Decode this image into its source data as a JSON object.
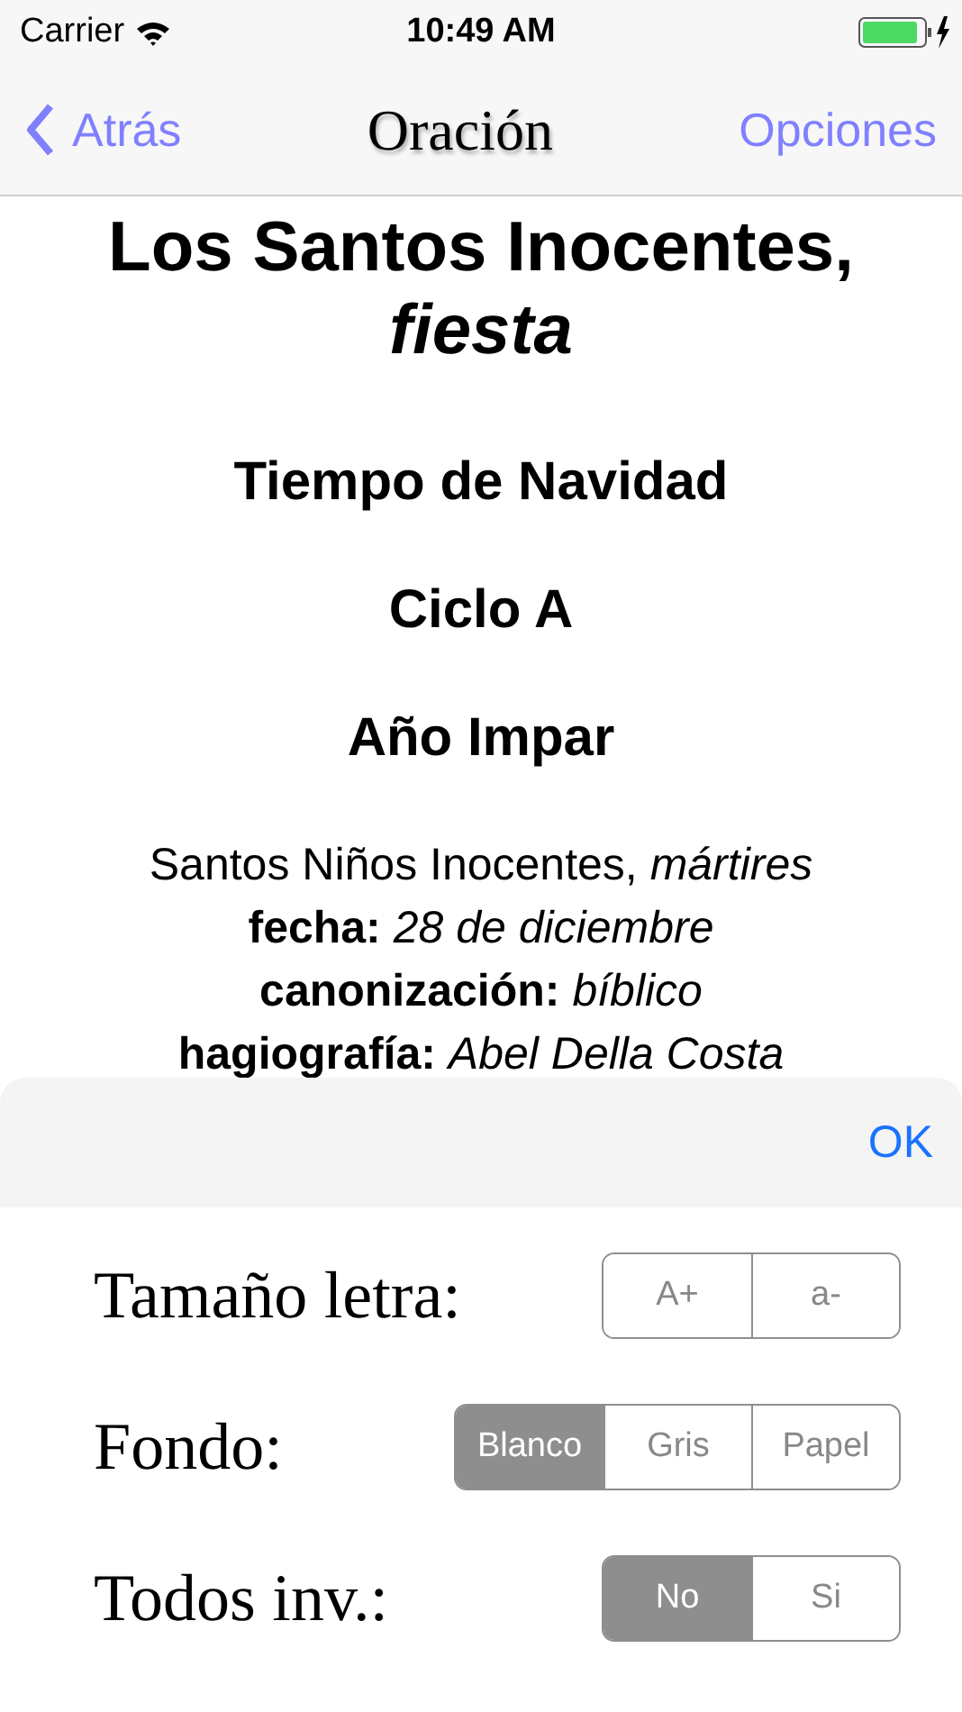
{
  "status_bar": {
    "carrier": "Carrier",
    "time": "10:49 AM"
  },
  "nav": {
    "back": "Atrás",
    "title": "Oración",
    "action": "Opciones"
  },
  "content": {
    "title": "Los Santos Inocentes, *fiesta*",
    "headings": [
      "Tiempo de Navidad",
      "Ciclo A",
      "Año Impar"
    ],
    "details": [
      "Santos Niños Inocentes, *mártires*",
      "**fecha:** *28 de diciembre*",
      "**canonización:** *bíblico*",
      "**hagiografía:** *Abel Della Costa*"
    ]
  },
  "options_sheet": {
    "done": "OK",
    "rows": [
      {
        "label": "Tamaño letra:",
        "kind": "buttons",
        "segments": [
          {
            "label": "A+",
            "selected": false
          },
          {
            "label": "a-",
            "selected": false
          }
        ]
      },
      {
        "label": "Fondo:",
        "kind": "segmented",
        "segments": [
          {
            "label": "Blanco",
            "selected": true
          },
          {
            "label": "Gris",
            "selected": false
          },
          {
            "label": "Papel",
            "selected": false
          }
        ]
      },
      {
        "label": "Todos inv.:",
        "kind": "segmented",
        "segments": [
          {
            "label": "No",
            "selected": true
          },
          {
            "label": "Si",
            "selected": false
          }
        ]
      }
    ]
  }
}
